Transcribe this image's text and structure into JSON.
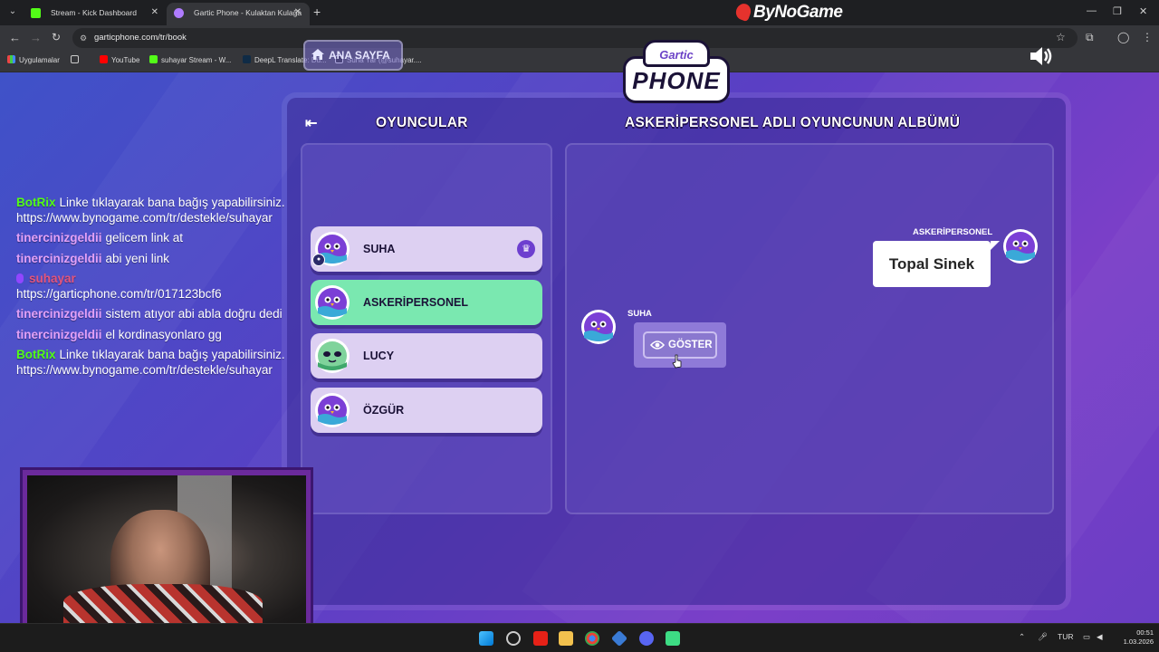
{
  "browser": {
    "tabs": [
      {
        "title": "Stream - Kick Dashboard",
        "favicon_color": "#53fc18"
      },
      {
        "title": "Gartic Phone - Kulaktan Kulağa",
        "favicon_color": "#b07cff"
      }
    ],
    "brand": "ByNoGame",
    "url": "garticphone.com/tr/book",
    "bookmarks": [
      {
        "label": "Uygulamalar",
        "icon": "apps-icon"
      },
      {
        "label": "YouTube",
        "icon": "youtube-icon"
      },
      {
        "label": "suhayar Stream - W...",
        "icon": "kick-icon"
      },
      {
        "label": "DeepL Translate: Dü...",
        "icon": "deepl-icon"
      },
      {
        "label": "Suha Yar (@suhayar....",
        "icon": "tiktok-icon"
      }
    ]
  },
  "game": {
    "home_button": "ANA SAYFA",
    "logo_top": "Gartic",
    "logo_word": "PHONE",
    "players_heading": "OYUNCULAR",
    "album_heading": "ASKERİPERSONEL ADLI OYUNCUNUN ALBÜMÜ",
    "players": [
      {
        "name": "SUHA",
        "host": true,
        "self": true
      },
      {
        "name": "ASKERİPERSONEL",
        "active": true
      },
      {
        "name": "LUCY"
      },
      {
        "name": "ÖZGÜR"
      }
    ],
    "album": {
      "first_author": "ASKERİPERSONEL",
      "first_text": "Topal Sinek",
      "second_author": "SUHA",
      "show_button": "GÖSTER"
    }
  },
  "chat": {
    "messages": [
      {
        "user": "BotRix",
        "text": "Linke tıklayarak bana bağış yapabilirsiniz. https://www.bynogame.com/tr/destekle/suhayar"
      },
      {
        "user": "tinercinizgeldii",
        "text": "gelicem link at"
      },
      {
        "user": "tinercinizgeldii",
        "text": "abi yeni link"
      },
      {
        "user": "suhayar",
        "text": "https://garticphone.com/tr/017123bcf6"
      },
      {
        "user": "tinercinizgeldii",
        "text": "sistem atıyor abi abla doğru dedi"
      },
      {
        "user": "tinercinizgeldii",
        "text": "el kordinasyonlaro gg"
      },
      {
        "user": "BotRix",
        "text": "Linke tıklayarak bana bağış yapabilirsiniz. https://www.bynogame.com/tr/destekle/suhayar"
      }
    ]
  },
  "taskbar": {
    "language": "TUR",
    "time": "00:51",
    "date": "1.03.2026"
  },
  "colors": {
    "active_player": "#7ae8b0",
    "player": "#ddd0f2",
    "botrix": "#53fc18",
    "viewer": "#e3a1f7"
  }
}
